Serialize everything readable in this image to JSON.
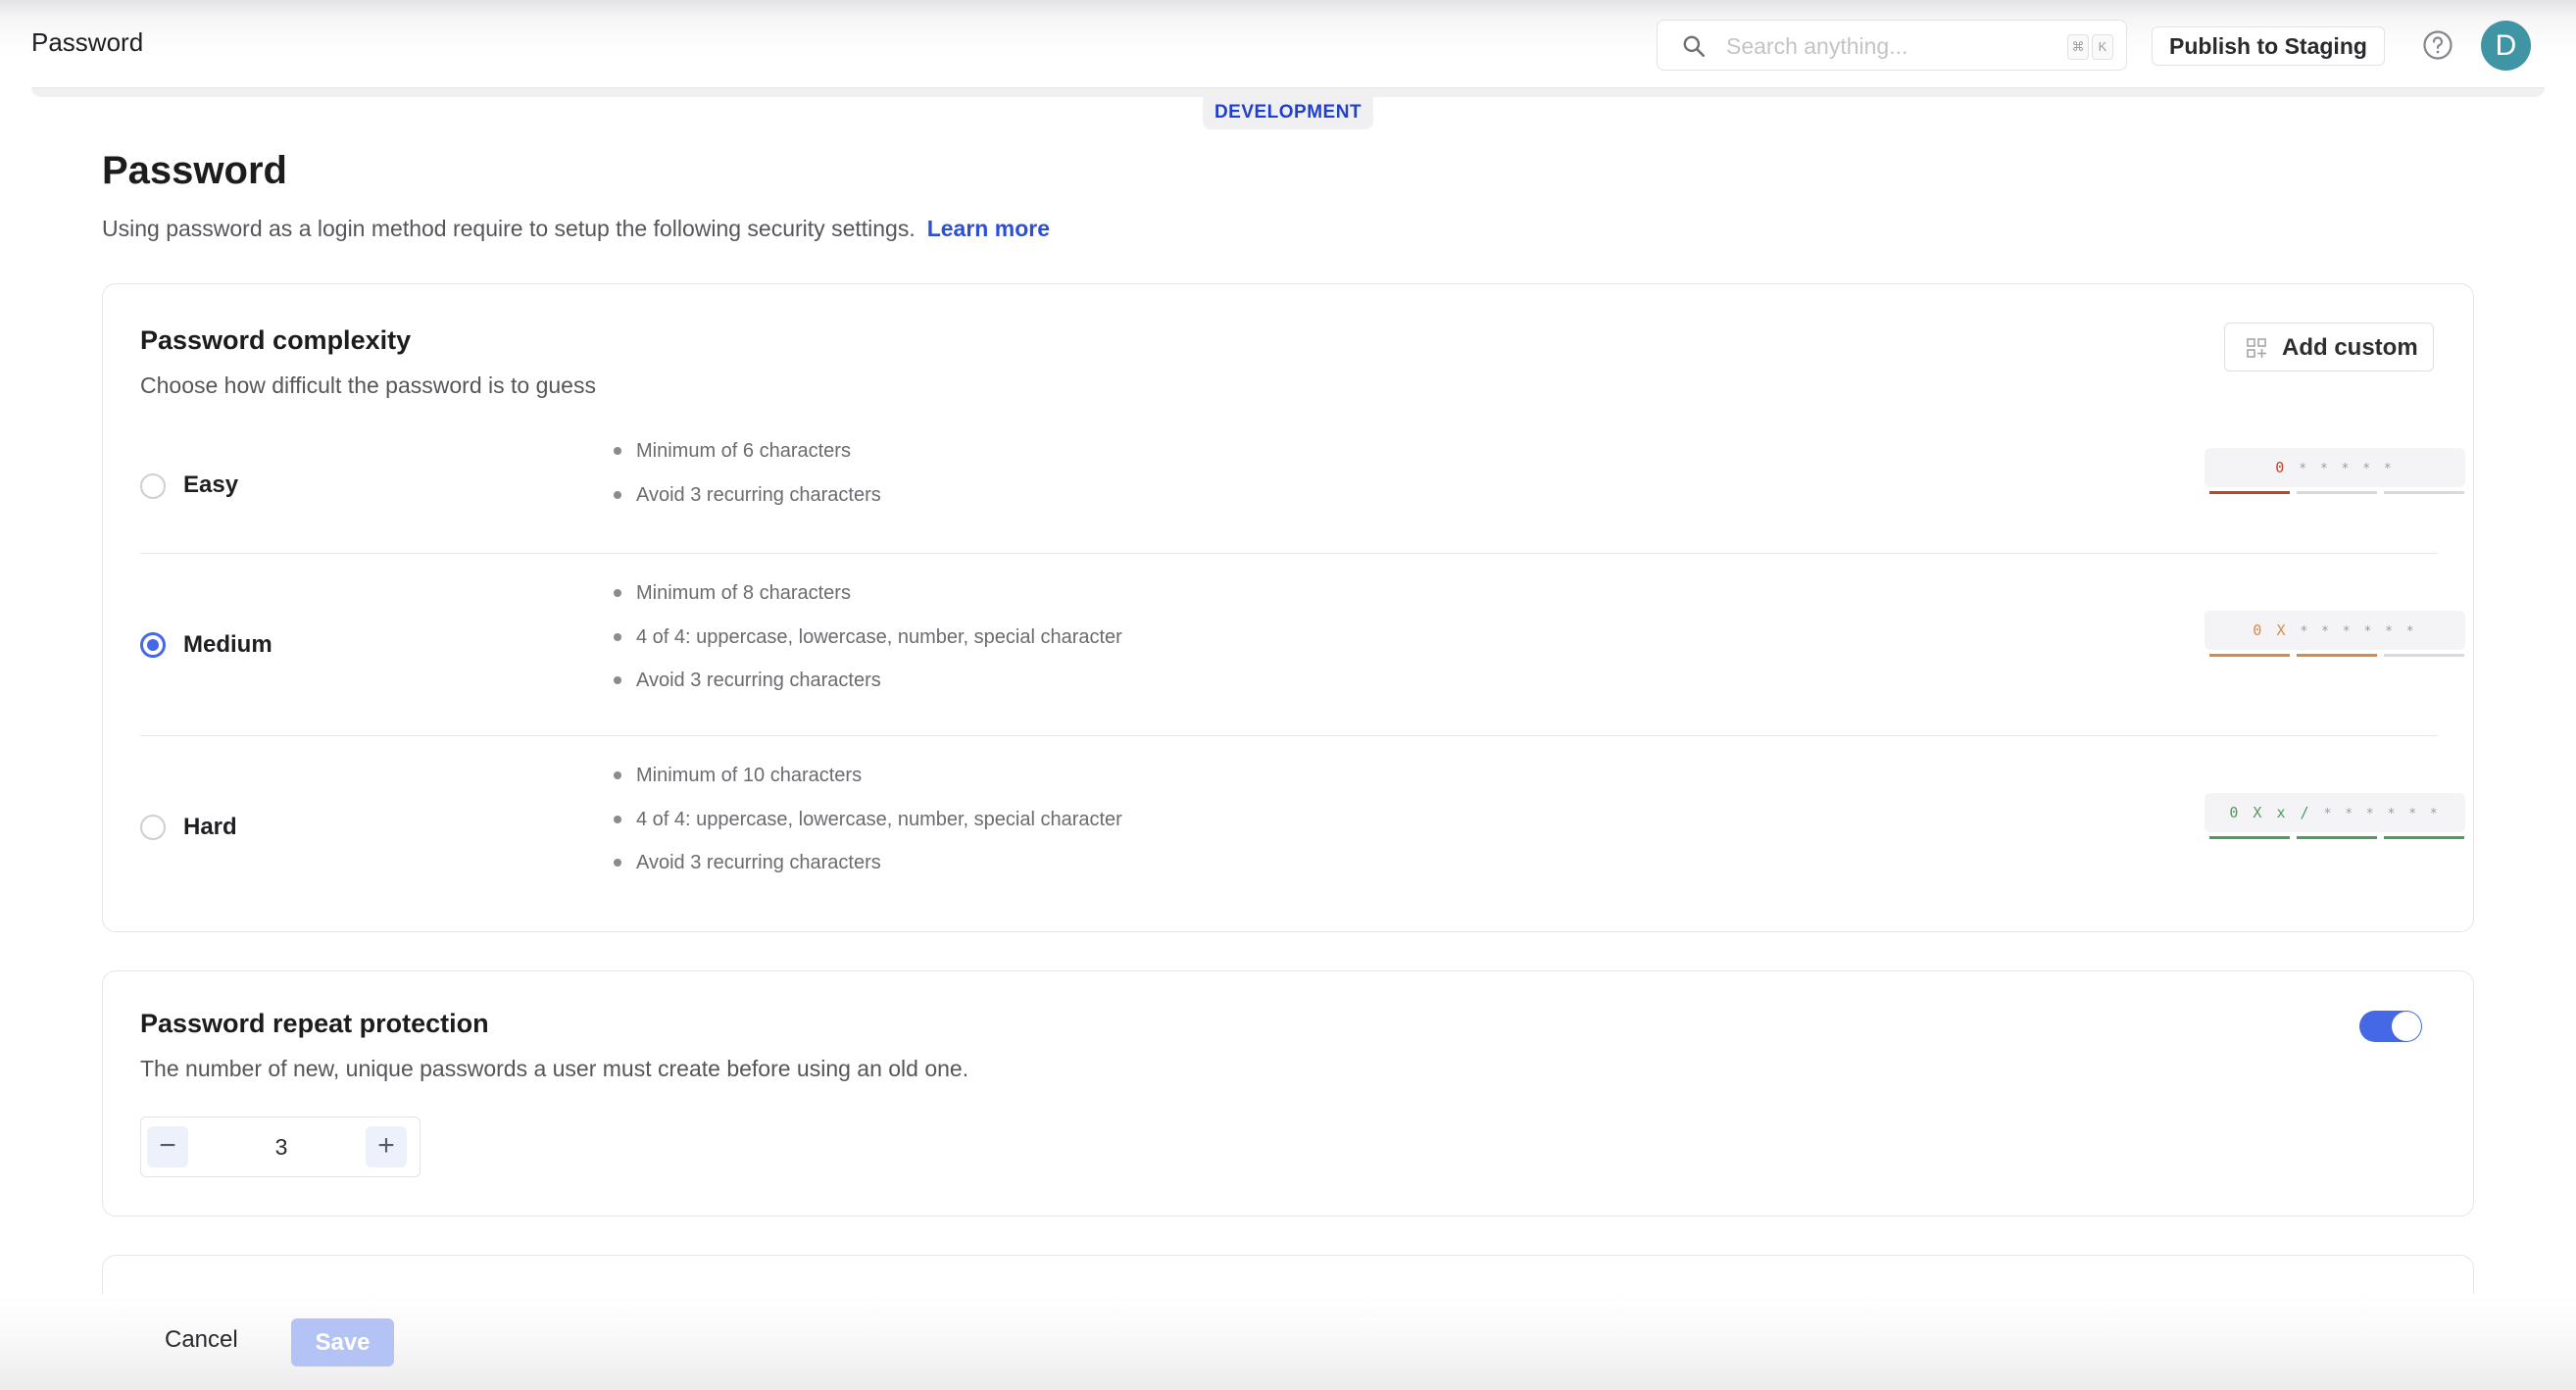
{
  "topbar": {
    "title": "Password",
    "search": {
      "placeholder": "Search anything...",
      "shortcut": [
        "⌘",
        "K"
      ]
    },
    "publish_label": "Publish to Staging",
    "avatar_initial": "D"
  },
  "environment_badge": "DEVELOPMENT",
  "page": {
    "title": "Password",
    "description": "Using password as a login method require to setup the following security settings.",
    "learn_more": "Learn more"
  },
  "complexity": {
    "title": "Password complexity",
    "subtitle": "Choose how difficult the password is to guess",
    "add_custom_label": "Add custom",
    "selected": "Medium",
    "levels": [
      {
        "label": "Easy",
        "checked": false,
        "rules": [
          "Minimum of 6 characters",
          "Avoid 3 recurring characters"
        ],
        "meter": {
          "typed": "0",
          "mask": "* * * * *",
          "color": "#c0432a",
          "filled_segments": 1,
          "total_segments": 3
        }
      },
      {
        "label": "Medium",
        "checked": true,
        "rules": [
          "Minimum of 8 characters",
          "4 of 4: uppercase, lowercase, number, special character",
          "Avoid 3 recurring characters"
        ],
        "meter": {
          "typed": "0 X",
          "mask": "* * * * * *",
          "color": "#d98a45",
          "filled_segments": 2,
          "total_segments": 3
        }
      },
      {
        "label": "Hard",
        "checked": false,
        "rules": [
          "Minimum of 10 characters",
          "4 of 4: uppercase, lowercase, number, special character",
          "Avoid 3 recurring characters"
        ],
        "meter": {
          "typed": "0 X x /",
          "mask": "* * * * * *",
          "color": "#4f9a5e",
          "filled_segments": 3,
          "total_segments": 3
        }
      }
    ]
  },
  "repeat_protection": {
    "title": "Password repeat protection",
    "description": "The number of new, unique passwords a user must create before using an old one.",
    "enabled": true,
    "value": "3",
    "decrement": "−",
    "increment": "+"
  },
  "footer": {
    "cancel_label": "Cancel",
    "save_label": "Save",
    "save_disabled": true
  },
  "colors": {
    "accent": "#4568e6",
    "link": "#2b4fd8",
    "avatar": "#3f95a3",
    "badge_text": "#1e3fd0"
  }
}
